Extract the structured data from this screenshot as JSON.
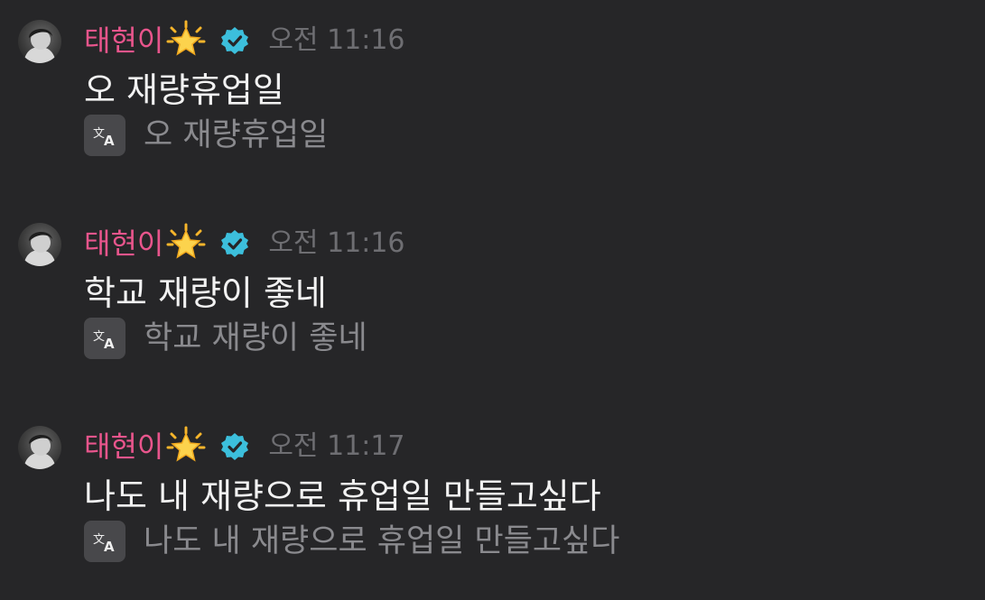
{
  "colors": {
    "background": "#262628",
    "username": "#e8558c",
    "message_text": "#f2f2f2",
    "timestamp": "#6e6e72",
    "translation_text": "#8a8a8e",
    "verified_badge": "#3cbfdc"
  },
  "messages": [
    {
      "avatar_icon": "avatar-photo",
      "username": "태현이",
      "username_emoji": "glowing-star-icon",
      "badge_icon": "verified-badge-icon",
      "timestamp": "오전 11:16",
      "text": "오 재량휴업일",
      "translation_icon": "translate-icon",
      "translation": "오 재량휴업일"
    },
    {
      "avatar_icon": "avatar-photo",
      "username": "태현이",
      "username_emoji": "glowing-star-icon",
      "badge_icon": "verified-badge-icon",
      "timestamp": "오전 11:16",
      "text": "학교 재량이 좋네",
      "translation_icon": "translate-icon",
      "translation": "학교 재량이 좋네"
    },
    {
      "avatar_icon": "avatar-photo",
      "username": "태현이",
      "username_emoji": "glowing-star-icon",
      "badge_icon": "verified-badge-icon",
      "timestamp": "오전 11:17",
      "text": "나도 내 재량으로 휴업일 만들고싶다",
      "translation_icon": "translate-icon",
      "translation": "나도 내 재량으로 휴업일 만들고싶다"
    }
  ]
}
